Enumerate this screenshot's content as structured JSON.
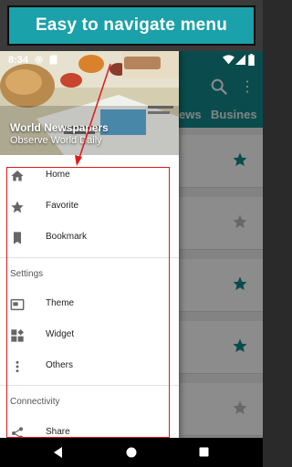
{
  "banner": {
    "text": "Easy to navigate menu"
  },
  "statusbar": {
    "time": "8:34"
  },
  "drawer": {
    "title": "World Newspapers",
    "subtitle": "Observe World Daily",
    "items": [
      {
        "label": "Home",
        "icon": "home-icon"
      },
      {
        "label": "Favorite",
        "icon": "star-icon"
      },
      {
        "label": "Bookmark",
        "icon": "bookmark-icon"
      }
    ],
    "sections": [
      {
        "title": "Settings",
        "items": [
          {
            "label": "Theme",
            "icon": "theme-icon"
          },
          {
            "label": "Widget",
            "icon": "widget-icon"
          },
          {
            "label": "Others",
            "icon": "more-vert-icon"
          }
        ]
      },
      {
        "title": "Connectivity",
        "items": [
          {
            "label": "Share",
            "icon": "share-icon"
          }
        ]
      }
    ]
  },
  "app": {
    "tabs": [
      "ews",
      "Busines"
    ],
    "list_stars": [
      "filled",
      "outline",
      "filled",
      "filled",
      "outline"
    ]
  },
  "colors": {
    "toolbar": "#138a8c",
    "banner": "#1aa1aa",
    "star_filled": "#138a8c",
    "star_outline": "#bdbdbd",
    "highlight": "#e01a1a"
  }
}
